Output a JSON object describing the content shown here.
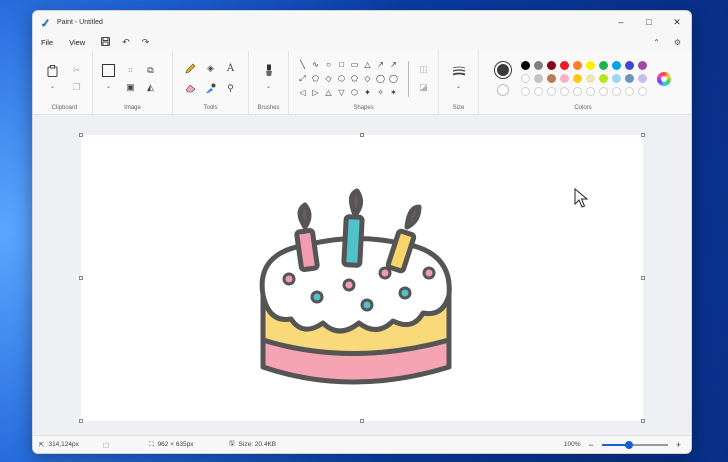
{
  "window": {
    "title": "Paint - Untitled",
    "controls": {
      "minimize": "–",
      "maximize": "□",
      "close": "✕"
    }
  },
  "menu": {
    "items": [
      "File",
      "View"
    ],
    "icons": [
      "save-icon",
      "undo-icon",
      "redo-icon"
    ],
    "right_icons": [
      "collapse-ribbon-icon",
      "settings-icon"
    ]
  },
  "ribbon": {
    "groups": {
      "clipboard": "Clipboard",
      "image": "Image",
      "tools": "Tools",
      "brushes": "Brushes",
      "shapes": "Shapes",
      "size": "Size",
      "colors": "Colors"
    },
    "shape_glyphs": [
      "╲",
      "∿",
      "○",
      "□",
      "▭",
      "△",
      "↗",
      "↗",
      "⤢",
      "⬠",
      "◇",
      "⬡",
      "⬠",
      "◇",
      "◯",
      "◯",
      "◁",
      "▷",
      "△",
      "▽",
      "⬡",
      "✦",
      "✧",
      "✶"
    ],
    "primary_color": "#3b3b3b",
    "secondary_color": "#ffffff",
    "palette": [
      "#000000",
      "#7f7f7f",
      "#880015",
      "#ed1c24",
      "#ff7f27",
      "#fff200",
      "#22b14c",
      "#00a2e8",
      "#3f48cc",
      "#a349a4",
      "#ffffff",
      "#c3c3c3",
      "#b97a57",
      "#ffaec9",
      "#ffc90e",
      "#efe4b0",
      "#b5e61d",
      "#99d9ea",
      "#7092be",
      "#c8bfe7"
    ]
  },
  "status": {
    "cursor_pos": "314,124px",
    "canvas_size": "962 × 635px",
    "file_size": "Size: 20.4KB",
    "zoom": "100%",
    "zoom_minus": "−",
    "zoom_plus": "+",
    "zoom_level": 0.42
  }
}
